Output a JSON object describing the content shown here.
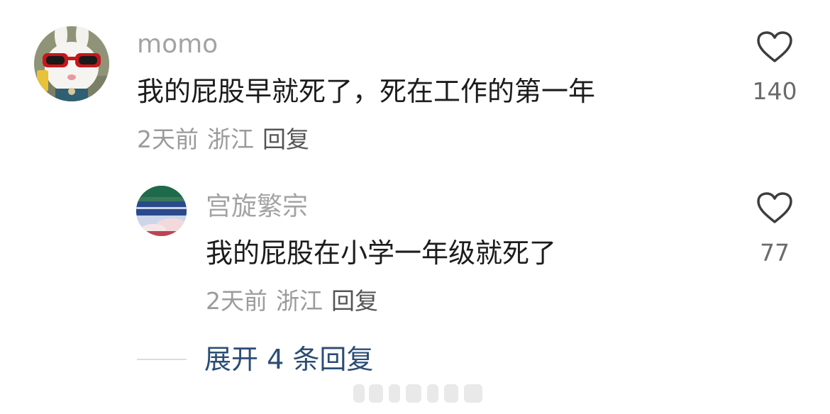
{
  "comments": [
    {
      "username": "momo",
      "text": "我的屁股早就死了，死在工作的第一年",
      "time": "2天前",
      "location": "浙江",
      "reply_label": "回复",
      "like_count": "140",
      "avatar_icon": "white-rabbit-red-sunglasses-avatar"
    }
  ],
  "reply": {
    "username": "宫旋繁宗",
    "text": "我的屁股在小学一年级就死了",
    "time": "2天前",
    "location": "浙江",
    "reply_label": "回复",
    "like_count": "77",
    "avatar_icon": "landscape-sky-avatar"
  },
  "expand_label": "展开 4 条回复",
  "icons": {
    "like": "heart-outline-icon"
  },
  "colors": {
    "username": "#a3a3a3",
    "text": "#1c1c1c",
    "meta": "#9b9b9b",
    "expand": "#2b4d75"
  }
}
